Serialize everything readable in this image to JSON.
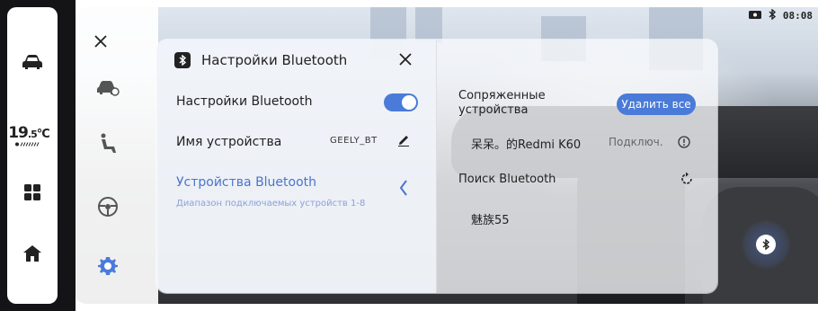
{
  "status_bar": {
    "time": "08:08"
  },
  "rail": {
    "temperature": "19.5°C",
    "temperature_main": "19",
    "temperature_decimal": ".5",
    "temperature_unit": "°C"
  },
  "bluetooth_panel": {
    "title": "Настройки Bluetooth",
    "settings_label": "Настройки Bluetooth",
    "toggle_on": true,
    "device_name_label": "Имя устройства",
    "device_name_value": "GEELY_BT",
    "devices_label": "Устройства Bluetooth",
    "devices_range": "Диапазон подключаемых устройств 1-8",
    "paired_title": "Сопряженные устройства",
    "delete_all_label": "Удалить все",
    "paired_device_name": "呆呆。的Redmi K60",
    "paired_device_status": "Подключ.",
    "search_title": "Поиск Bluetooth",
    "found_device_name": "魅族55"
  },
  "icons": {
    "rail": [
      "car-icon",
      "grid-icon",
      "home-icon"
    ],
    "column": [
      "close-icon",
      "vehicle-settings-icon",
      "seat-icon",
      "steering-wheel-icon",
      "gear-icon"
    ]
  },
  "colors": {
    "accent": "#4a7bd8",
    "active_text": "#4a74cf",
    "active_subtext": "#8aa2d8"
  }
}
